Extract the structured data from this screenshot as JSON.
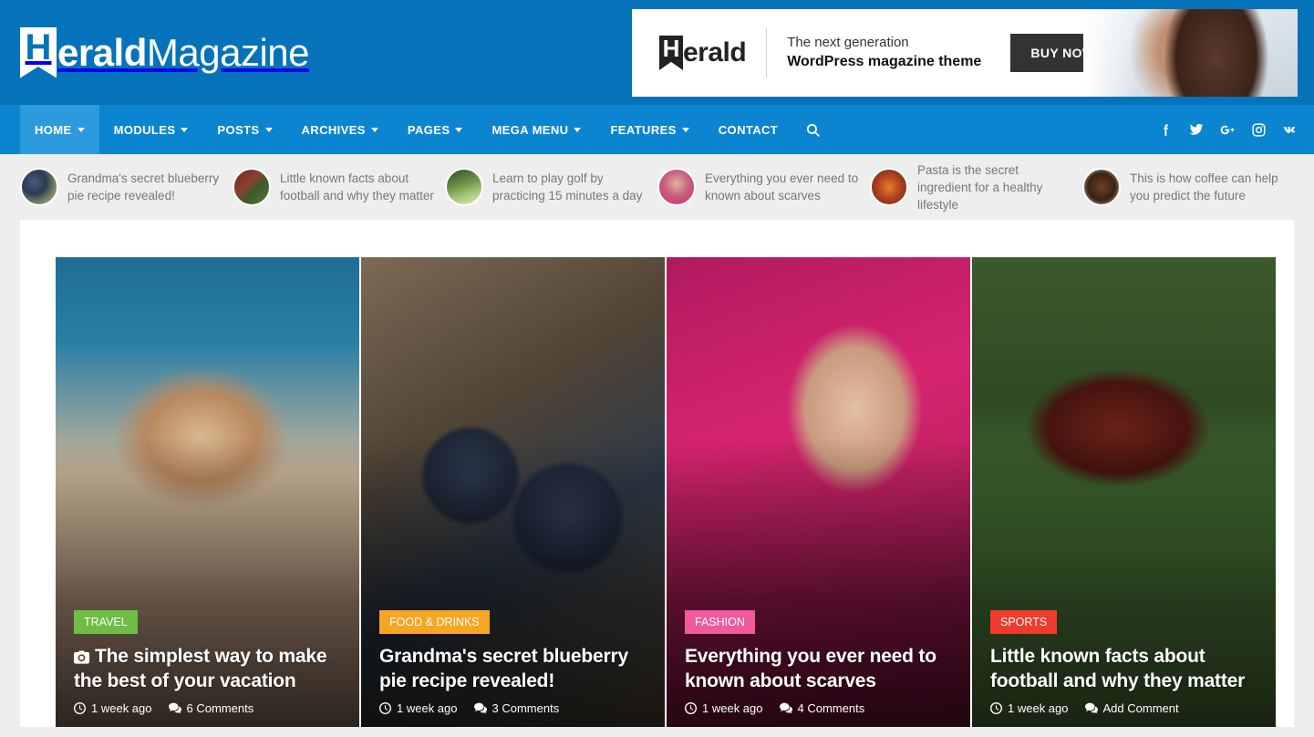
{
  "header": {
    "logo": {
      "mark_letter": "H",
      "bold_part": "erald",
      "light_part": "Magazine"
    }
  },
  "banner": {
    "logo_mark_letter": "H",
    "logo_text": "erald",
    "line1": "The next generation",
    "line2": "WordPress magazine theme",
    "cta_label": "BUY NOW!"
  },
  "nav": {
    "items": [
      {
        "label": "HOME",
        "has_dropdown": true,
        "active": true
      },
      {
        "label": "MODULES",
        "has_dropdown": true,
        "active": false
      },
      {
        "label": "POSTS",
        "has_dropdown": true,
        "active": false
      },
      {
        "label": "ARCHIVES",
        "has_dropdown": true,
        "active": false
      },
      {
        "label": "PAGES",
        "has_dropdown": true,
        "active": false
      },
      {
        "label": "MEGA MENU",
        "has_dropdown": true,
        "active": false
      },
      {
        "label": "FEATURES",
        "has_dropdown": true,
        "active": false
      },
      {
        "label": "CONTACT",
        "has_dropdown": false,
        "active": false
      }
    ],
    "search_icon": "search-icon",
    "social": [
      {
        "name": "facebook-icon",
        "glyph": "f"
      },
      {
        "name": "twitter-icon",
        "glyph": ""
      },
      {
        "name": "google-plus-icon",
        "glyph": "G+"
      },
      {
        "name": "instagram-icon",
        "glyph": ""
      },
      {
        "name": "vk-icon",
        "glyph": "vk"
      }
    ]
  },
  "ticker": {
    "items": [
      {
        "title": "Grandma's secret blueberry pie recipe revealed!",
        "thumb": "blueberries-thumb"
      },
      {
        "title": "Little known facts about football and why they matter",
        "thumb": "football-thumb"
      },
      {
        "title": "Learn to play golf by practicing 15 minutes a day",
        "thumb": "golf-thumb"
      },
      {
        "title": "Everything you ever need to known about scarves",
        "thumb": "scarf-thumb"
      },
      {
        "title": "Pasta is the secret ingredient for a healthy lifestyle",
        "thumb": "pasta-thumb"
      },
      {
        "title": "This is how coffee can help you predict the future",
        "thumb": "coffee-thumb"
      }
    ]
  },
  "featured": {
    "cards": [
      {
        "category": "TRAVEL",
        "category_color": "#6fbd44",
        "title": "The simplest way to make the best of your vacation",
        "time": "1 week ago",
        "comments": "6 Comments",
        "has_camera_icon": true
      },
      {
        "category": "FOOD & DRINKS",
        "category_color": "#f5a623",
        "title": "Grandma's secret blueberry pie recipe revealed!",
        "time": "1 week ago",
        "comments": "3 Comments",
        "has_camera_icon": false
      },
      {
        "category": "FASHION",
        "category_color": "#ef5a9c",
        "title": "Everything you ever need to known about scarves",
        "time": "1 week ago",
        "comments": "4 Comments",
        "has_camera_icon": false
      },
      {
        "category": "SPORTS",
        "category_color": "#ef3b2d",
        "title": "Little known facts about football and why they matter",
        "time": "1 week ago",
        "comments": "Add Comment",
        "has_camera_icon": false
      }
    ]
  },
  "colors": {
    "header_blue": "#0573b9",
    "nav_blue": "#0c85d0",
    "nav_active_blue": "#2e9ade",
    "page_bg": "#eeeeee",
    "content_bg": "#ffffff"
  }
}
